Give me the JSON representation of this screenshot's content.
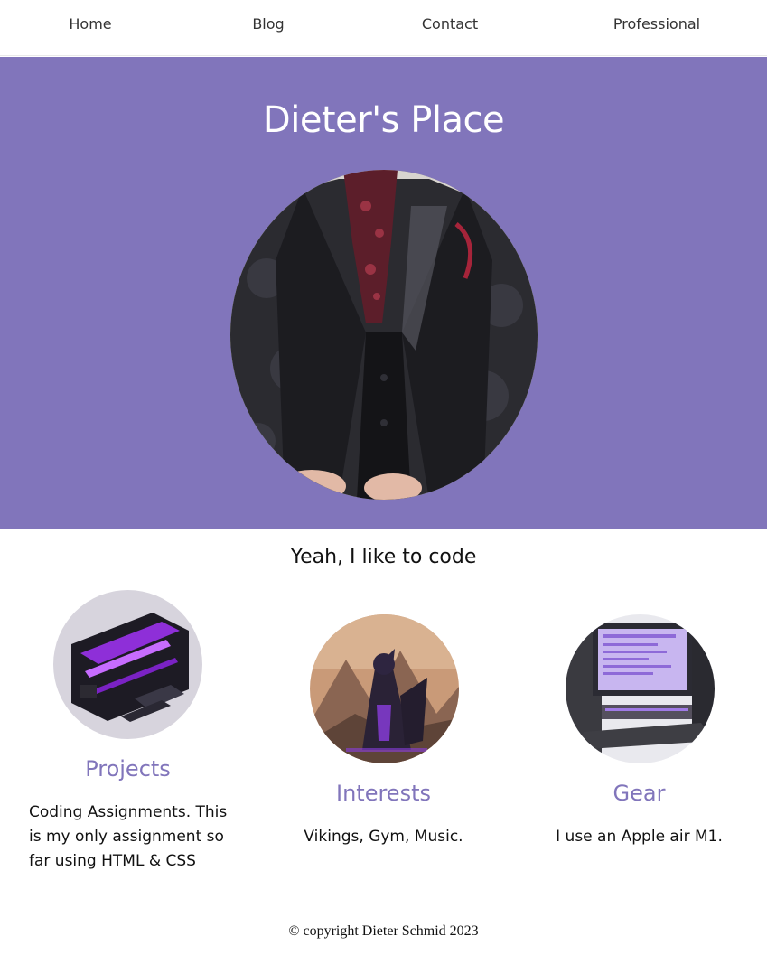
{
  "nav": {
    "items": [
      {
        "label": "Home"
      },
      {
        "label": "Blog"
      },
      {
        "label": "Contact"
      },
      {
        "label": "Professional"
      }
    ]
  },
  "hero": {
    "title": "Dieter's Place",
    "background_color": "#8175bb",
    "photo_icon": "portrait-photo"
  },
  "main": {
    "tagline": "Yeah, I like to code",
    "cards": [
      {
        "title": "Projects",
        "text": "Coding Assignments. This is my only assignment so far using HTML & CSS",
        "image_icon": "hardware-render-image"
      },
      {
        "title": "Interests",
        "text": "Vikings, Gym, Music.",
        "image_icon": "viking-warrior-image"
      },
      {
        "title": "Gear",
        "text": "I use an Apple air M1.",
        "image_icon": "computer-setup-image"
      }
    ],
    "accent_color": "#8175bb"
  },
  "footer": {
    "copyright": "© copyright Dieter Schmid 2023"
  }
}
